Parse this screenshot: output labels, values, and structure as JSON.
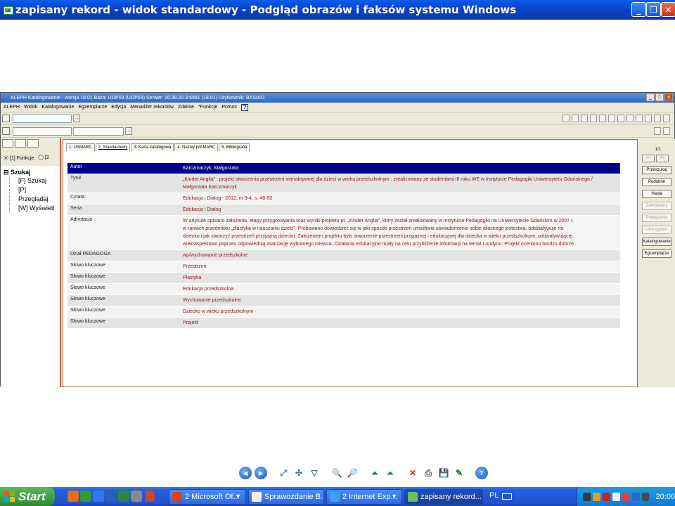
{
  "viewer": {
    "title": "zapisany rekord - widok standardowy - Podgląd obrazów i faksów systemu Windows",
    "controls": {
      "minimize": "_",
      "maximize": "❐",
      "close": "✕"
    }
  },
  "aleph": {
    "title": "ALEPH Katalogowanie - wersja 18.01  Baza: UOP03 (UOP03)  Serwer: 10.39.20.3:6991 (18.01)  Użytkownik: BASIAO",
    "menu": [
      "ALEPH",
      "Widok",
      "Katalogowanie",
      "Egzemplarze",
      "Edycja",
      "Menadżer rekordów",
      "Zdalnie",
      "*Funkcje",
      "Pomoc"
    ],
    "help_label": "?",
    "left": {
      "radio_1": "⦿ [1] Funkcje",
      "radio_2": "◯ [2",
      "root": "⊟ Szukaj",
      "items": [
        "[F] Szukaj",
        "[P] Przeglądaj",
        "[W] Wyświetl"
      ]
    },
    "tabs": [
      "1. USMARC",
      "2. Standardowy",
      "3. Karta katalogowa",
      "4. Nazwy pól MARC",
      "5. Bibliografia"
    ],
    "record": [
      {
        "label": "Autor",
        "value": "Karczmarzyk, Małgorzata."
      },
      {
        "label": "Tytuł",
        "value": "„Kinder Anglia” : projekt stworzenia przestrzeni interaktywnej dla dzieci w wieku przedszkolnym : zrealizowany ze studentami III roku WE w Instytucie Pedagogiki Uniwersytetu Gdańskiego / Małgorzata Karczmarzyk"
      },
      {
        "label": "Cytata:",
        "value": "Edukacja i Dialog - 2012, nr 3-4, s. 48-50"
      },
      {
        "label": "Seria",
        "value": "Edukacja i Dialog"
      },
      {
        "label": "Adnotacja",
        "value": "W artykule opisano założenia, etapy przygotowania oraz wyniki projektu pt. „Kinder Anglia”, który został zrealizowany w Instytucie Pedagogiki na Uniwersytecie Gdańskim w 2007 r. w ramach przedmiotu „plastyka w nauczaniu dzieci”. Próbowano dowiedzieć się w jaki sposób przestrzeń umożliwia uświadomienie sobie własnego jestestwa, oddziaływuje na dziecko i jak stworzyć przestrzeń przyjazną dziecku. Założeniem projektu było stworzenie przestrzeni przyjaznej i edukacyjnej dla dziecka w wieku przedszkolnym, oddziaływującej wieloaspektowo poprzez odpowiednią aranżację wybranego miejsca. Działania edukacyjne miały na celu przybliżenie informacji na temat Londynu. Projekt oceniono bardzo dobrze."
      },
      {
        "label": "Dział PEDAGOGA",
        "value": "wp/wychowanie przedszkolne"
      },
      {
        "label": "Słowo kluczowe",
        "value": "Przestrzeń"
      },
      {
        "label": "Słowo kluczowe",
        "value": "Plastyka"
      },
      {
        "label": "Słowo kluczowe",
        "value": "Edukacja przedszkolna"
      },
      {
        "label": "Słowo kluczowe",
        "value": "Wychowanie przedszkolne"
      },
      {
        "label": "Słowo kluczowe",
        "value": "Dziecko w wieku przedszkolnym"
      },
      {
        "label": "Słowo kluczowe",
        "value": "Projekt"
      }
    ],
    "right": {
      "counter": "1/1",
      "prev": "<<",
      "next": ">>",
      "buttons": [
        {
          "label": "Przeszukaj",
          "enabled": true
        },
        {
          "label": "Podobne",
          "enabled": true
        },
        {
          "label": "Hasła",
          "enabled": true
        },
        {
          "label": "Zamówiony",
          "enabled": false
        },
        {
          "label": "Powiązania",
          "enabled": false
        },
        {
          "label": "Lista egzem.",
          "enabled": false
        },
        {
          "label": "Katalogowanie",
          "enabled": true
        },
        {
          "label": "Egzemplarze",
          "enabled": true
        }
      ]
    }
  },
  "taskbar": {
    "start": "Start",
    "tasks": [
      {
        "label": "2 Microsoft Of...",
        "color": "#e04020"
      },
      {
        "label": "Sprawozdanie B...",
        "color": "#f0f0f0"
      },
      {
        "label": "2 Internet Exp...",
        "color": "#3aa0ff"
      },
      {
        "label": "zapisany rekord...",
        "color": "#6abf5a"
      }
    ],
    "lang": "PL",
    "clock": "20:00"
  },
  "colors": {
    "selected_row": "#00008b",
    "value_text": "#8b1a1a",
    "panel_border": "#c06040"
  }
}
